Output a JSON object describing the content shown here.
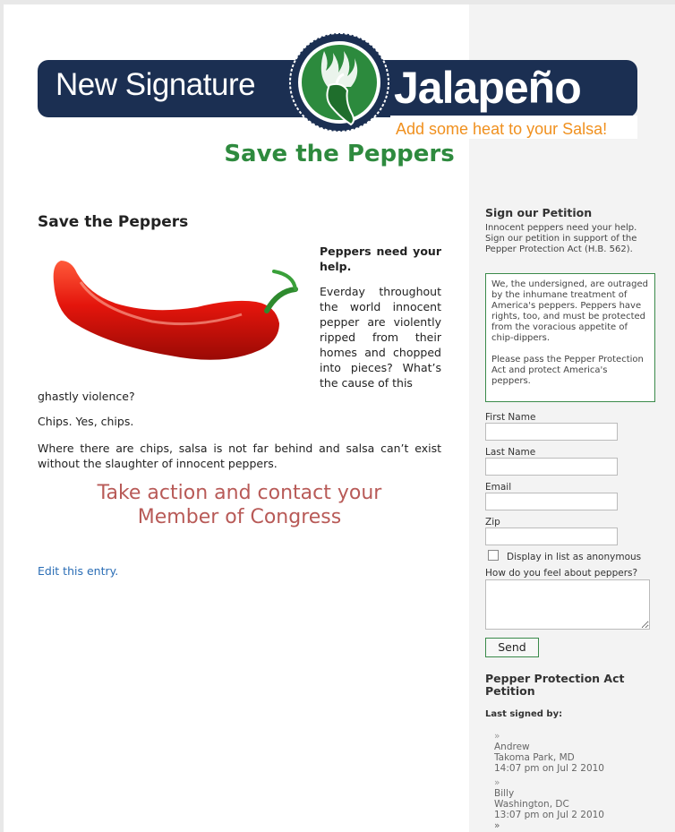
{
  "banner": {
    "left_text": "New Signature",
    "right_text": "Jalapeño",
    "tagline": "Add some heat to your Salsa!"
  },
  "site": {
    "title": "Save the Peppers"
  },
  "post": {
    "title": "Save the Peppers",
    "intro_heading": "Peppers need your help.",
    "intro_body": "Everday throughout the world innocent pepper are violently ripped from their homes and chopped into pieces? What’s the cause of this",
    "intro_tail": "ghastly violence?",
    "chips": "Chips.  Yes, chips.",
    "where": "Where there are chips, salsa is not far behind and salsa can’t exist without the slaughter of innocent peppers.",
    "cta_line1": "Take action and contact your",
    "cta_line2": "Member of Congress",
    "edit_link": "Edit this entry."
  },
  "sidebar": {
    "title": "Sign our Petition",
    "intro": "Innocent peppers need your help.  Sign our petition in support of the Pepper Protection Act (H.B. 562).",
    "petition_p1": "We, the undersigned, are outraged by the inhumane treatment of America's peppers. Peppers have rights, too, and must be protected from the voracious appetite of chip-dippers.",
    "petition_p2": "Please pass the Pepper Protection Act and protect America's peppers.",
    "form": {
      "first_name_label": "First Name",
      "last_name_label": "Last Name",
      "email_label": "Email",
      "zip_label": "Zip",
      "anonymous_label": "Display in list as anonymous",
      "feel_label": "How do you feel about peppers?",
      "send_label": "Send"
    },
    "list_title": "Pepper Protection Act Petition",
    "last_signed_label": "Last signed by:",
    "signers": [
      {
        "arrow": "»",
        "name": "Andrew",
        "location": "Takoma Park, MD",
        "time": "14:07 pm on Jul 2 2010"
      },
      {
        "arrow": "»",
        "name": "Billy",
        "location": "Washington, DC",
        "time": "13:07 pm on Jul 2 2010"
      }
    ],
    "more_arrow": "»"
  },
  "colors": {
    "banner_bg": "#1b2f52",
    "tagline": "#f0901e",
    "site_title": "#2e8a3e",
    "cta": "#b85a57",
    "link": "#2a6db5",
    "accent_border": "#3a8a4a"
  }
}
